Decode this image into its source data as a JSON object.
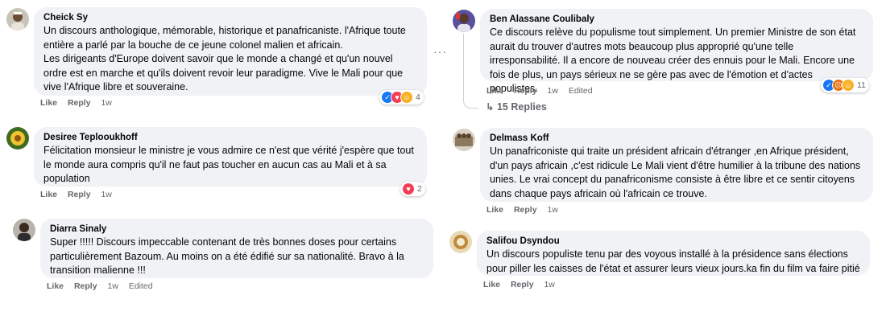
{
  "colors": {
    "bubble": "#f0f2f5",
    "meta_text": "#65676b",
    "like": "#1877f2",
    "love": "#f33e58",
    "haha": "#f7b125",
    "angry": "#e9710f"
  },
  "more_options_icon": "···",
  "left": [
    {
      "author": "Cheick Sy",
      "text": "Un discours anthologique, mémorable, historique et panafricaniste. l'Afrique toute entière a parlé par la bouche de ce jeune colonel malien et africain.\nLes dirigeants d'Europe doivent savoir que le monde a changé et qu'un nouvel ordre est en marche et qu'ils doivent revoir leur paradigme. Vive le Mali pour que vive l'Afrique libre et souveraine.",
      "like": "Like",
      "reply": "Reply",
      "time": "1w",
      "reaction_count": "4",
      "reaction_icons": [
        "like-icon",
        "love-icon",
        "haha-icon"
      ]
    },
    {
      "author": "Desiree Teplooukhoff",
      "text": "Félicitation monsieur le ministre je vous admire ce n'est que vérité j'espère que tout le monde aura compris qu'il ne faut pas toucher en aucun cas au Mali et à sa population",
      "like": "Like",
      "reply": "Reply",
      "time": "1w",
      "reaction_count": "2",
      "reaction_icons": [
        "love-icon"
      ]
    },
    {
      "author": "Diarra Sinaly",
      "text": "Super !!!!! Discours impeccable contenant de très bonnes doses pour certains particulièrement Bazoum. Au moins on a été édifié sur sa nationalité. Bravo à la transition malienne !!!",
      "like": "Like",
      "reply": "Reply",
      "time": "1w",
      "edited": "Edited"
    }
  ],
  "right": [
    {
      "author": "Ben Alassane Coulibaly",
      "text": "Ce discours relève du populisme tout simplement. Un premier Ministre de son état aurait du trouver d'autres mots beaucoup plus approprié qu'une telle irresponsabilité. Il a encore de nouveau créer des ennuis pour le Mali. Encore une fois de plus, un pays sérieux ne se gère pas avec de l'émotion et d'actes populistes.",
      "like": "Like",
      "reply": "Reply",
      "time": "1w",
      "edited": "Edited",
      "reaction_count": "11",
      "reaction_icons": [
        "like-icon",
        "angry-icon",
        "haha-icon"
      ],
      "replies": "15 Replies"
    },
    {
      "author": "Delmass Koff",
      "text": "Un panafriconiste qui traite un président africain d'étranger ,en Afrique président, d'un pays africain ,c'est ridicule Le Mali vient d'être humilier à la tribune des nations unies. Le vrai concept du panafriconisme consiste à être libre et ce sentir citoyens dans chaque pays africain où l'africain ce trouve.",
      "like": "Like",
      "reply": "Reply",
      "time": "1w"
    },
    {
      "author": "Salifou Dsyndou",
      "text": "Un discours populiste tenu par des voyous installé à la présidence sans élections pour piller les caisses de l'état et assurer leurs vieux jours.ka fin du film va faire pitié",
      "like": "Like",
      "reply": "Reply",
      "time": "1w"
    }
  ]
}
